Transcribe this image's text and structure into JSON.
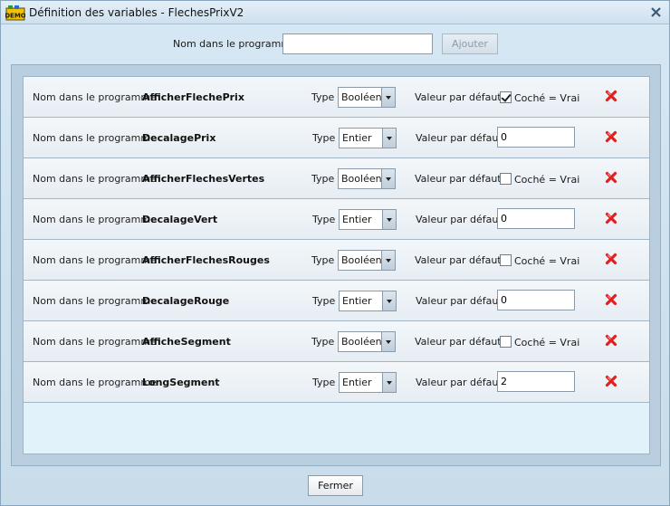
{
  "window": {
    "title": "Définition des variables - FlechesPrixV2",
    "icon": "demo-app-icon"
  },
  "top": {
    "label": "Nom dans le programme",
    "input_value": "",
    "add_label": "Ajouter"
  },
  "common": {
    "name_label": "Nom dans le programme",
    "type_label": "Type",
    "default_label": "Valeur par défaut",
    "checkbox_label": "Coché = Vrai"
  },
  "rows": [
    {
      "name": "AfficherFlechePrix",
      "type": "Booléen",
      "checked": true,
      "value": ""
    },
    {
      "name": "DecalagePrix",
      "type": "Entier",
      "checked": false,
      "value": "0"
    },
    {
      "name": "AfficherFlechesVertes",
      "type": "Booléen",
      "checked": false,
      "value": ""
    },
    {
      "name": "DecalageVert",
      "type": "Entier",
      "checked": false,
      "value": "0"
    },
    {
      "name": "AfficherFlechesRouges",
      "type": "Booléen",
      "checked": false,
      "value": ""
    },
    {
      "name": "DecalageRouge",
      "type": "Entier",
      "checked": false,
      "value": "0"
    },
    {
      "name": "AfficheSegment",
      "type": "Booléen",
      "checked": false,
      "value": ""
    },
    {
      "name": "LongSegment",
      "type": "Entier",
      "checked": false,
      "value": "2"
    }
  ],
  "footer": {
    "close_label": "Fermer"
  },
  "colors": {
    "delete": "#e02020",
    "accent": "#d4e6f3"
  }
}
